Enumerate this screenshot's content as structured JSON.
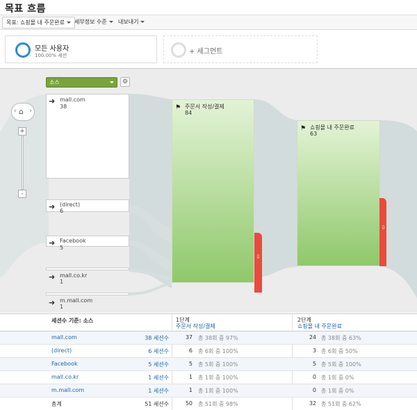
{
  "title": "목표 흐름",
  "toolbar": {
    "goal": "목표: 쇼핑몰 내 주문완료",
    "detail": "세부정보 수준",
    "export": "내보내기"
  },
  "segments": {
    "all_name": "모든 사용자",
    "all_sub": "100.00% 세션",
    "add_label": "+ 세그먼트"
  },
  "canvas": {
    "source_select": "소스",
    "nodes": [
      {
        "label": "mall.com",
        "value": "38"
      },
      {
        "label": "(direct)",
        "value": "6"
      },
      {
        "label": "Facebook",
        "value": "5"
      },
      {
        "label": "mall.co.kr",
        "value": "1"
      },
      {
        "label": "m.mall.com",
        "value": "1"
      }
    ],
    "steps": [
      {
        "label": "주문서 작성/결제",
        "value": "84"
      },
      {
        "label": "쇼핑몰 내 주문완료",
        "value": "63"
      }
    ],
    "colors": {
      "step_green": "#8fc86a",
      "exit_red": "#e94b3c",
      "flow": "#d3dcdc",
      "select_green": "#7aa33d"
    }
  },
  "table": {
    "header_source": "세션수 기준: 소스",
    "step1_label": "1단계",
    "step1_name": "주문서 작성/결제",
    "step2_label": "2단계",
    "step2_name": "쇼핑몰 내 주문완료",
    "rows": [
      {
        "source": "mall.com",
        "sessions": "38 세션수",
        "s1": "37",
        "s1_pct": "총 38회 중 97%",
        "s2": "24",
        "s2_pct": "총 38회 중 63%"
      },
      {
        "source": "(direct)",
        "sessions": "6 세션수",
        "s1": "6",
        "s1_pct": "총 6회 중 100%",
        "s2": "3",
        "s2_pct": "총 6회 중 50%"
      },
      {
        "source": "Facebook",
        "sessions": "5 세션수",
        "s1": "5",
        "s1_pct": "총 5회 중 100%",
        "s2": "5",
        "s2_pct": "총 5회 중 100%"
      },
      {
        "source": "mall.co.kr",
        "sessions": "1 세션수",
        "s1": "1",
        "s1_pct": "총 1회 중 100%",
        "s2": "0",
        "s2_pct": "총 1회 중 0%"
      },
      {
        "source": "m.mall.com",
        "sessions": "1 세션수",
        "s1": "1",
        "s1_pct": "총 1회 중 100%",
        "s2": "0",
        "s2_pct": "총 1회 중 0%"
      },
      {
        "source": "총계",
        "sessions": "51 세션수",
        "s1": "50",
        "s1_pct": "총 51회 중 98%",
        "s2": "32",
        "s2_pct": "총 51회 중 62%"
      }
    ]
  }
}
